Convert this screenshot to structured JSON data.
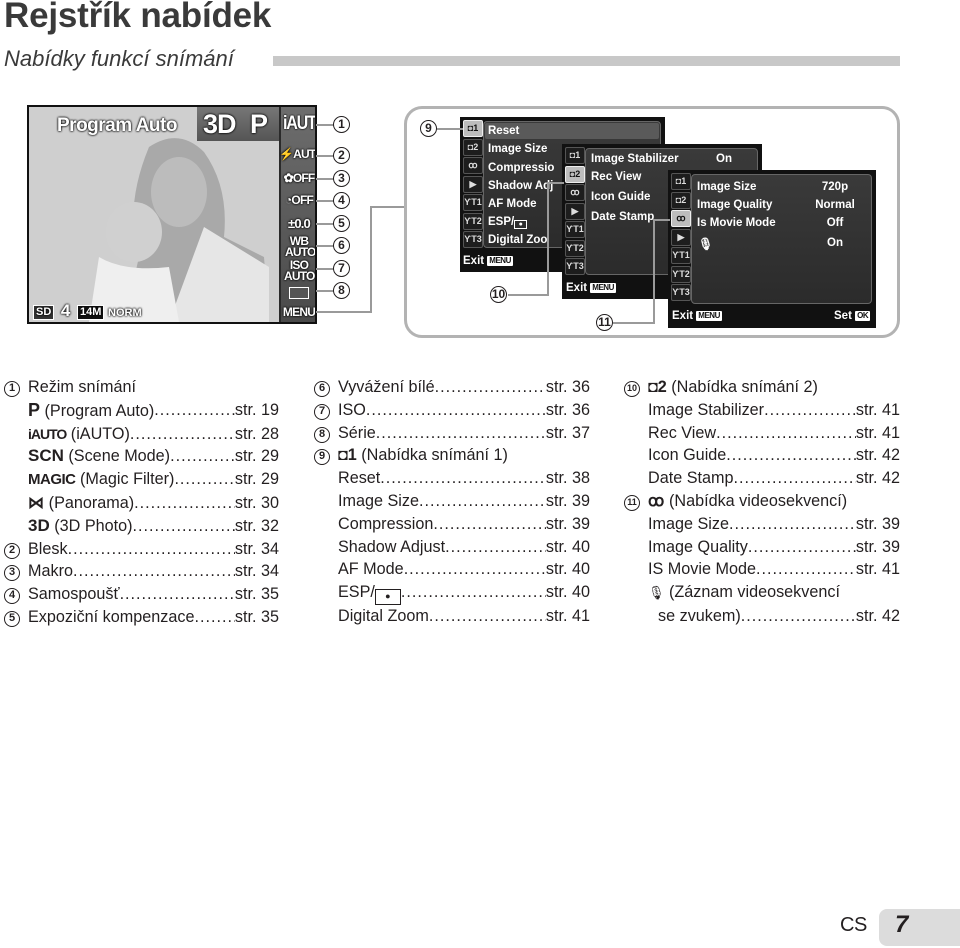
{
  "header": {
    "title": "Rejstřík nabídek",
    "subtitle": "Nabídky funkcí snímání"
  },
  "camera_screen": {
    "mode_label": "Program Auto",
    "mode_icons": [
      "3D",
      "P",
      "iAUTO"
    ],
    "side_items": [
      {
        "icon": "flash-auto-icon",
        "text": "⚡AUTO"
      },
      {
        "icon": "macro-off-icon",
        "text": "✿OFF"
      },
      {
        "icon": "self-timer-off-icon",
        "text": "◔OFF"
      },
      {
        "icon": "exposure-icon",
        "text": "±0.0"
      },
      {
        "icon": "white-balance-icon",
        "text": "WB AUTO"
      },
      {
        "icon": "iso-icon",
        "text": "ISO AUTO"
      },
      {
        "icon": "drive-mode-icon",
        "text": ""
      },
      {
        "icon": "menu-button",
        "text": "MENU"
      }
    ],
    "bottom": {
      "card": "SD",
      "shots": "4",
      "size": "14M",
      "quality": "NORM"
    }
  },
  "callouts": [
    "1",
    "2",
    "3",
    "4",
    "5",
    "6",
    "7",
    "8",
    "9",
    "10",
    "11"
  ],
  "menus": {
    "shooting1": {
      "items": [
        "Reset",
        "Image Size",
        "Compressio",
        "Shadow Adj",
        "AF Mode",
        "ESP/",
        "Digital Zoo"
      ],
      "exit": "Exit",
      "exit_key": "MENU"
    },
    "shooting2": {
      "items": [
        "Image Stabilizer",
        "Rec View",
        "Icon Guide",
        "Date Stamp"
      ],
      "values": [
        "On",
        "",
        "",
        ""
      ],
      "exit": "Exit",
      "exit_key": "MENU"
    },
    "movie": {
      "items": [
        "Image Size",
        "Image Quality",
        "Is Movie Mode",
        ""
      ],
      "values": [
        "720p",
        "Normal",
        "Off",
        "On"
      ],
      "exit": "Exit",
      "exit_key": "MENU",
      "set": "Set",
      "set_key": "OK"
    },
    "tabs": [
      "◘1",
      "◘2",
      "ꝏ",
      "▶",
      "ƳT1",
      "ƳT2",
      "ƳT3"
    ]
  },
  "index": {
    "col1": [
      {
        "num": "1",
        "label": "Režim snímání",
        "page": ""
      },
      {
        "icon": "P",
        "label": " (Program Auto)",
        "page": "str. 19"
      },
      {
        "icon": "iAUTO",
        "label": " (iAUTO)",
        "page": "str. 28"
      },
      {
        "icon": "SCN",
        "label": " (Scene Mode)",
        "page": "str. 29"
      },
      {
        "icon": "MAGIC",
        "label": " (Magic Filter)",
        "page": "str. 29"
      },
      {
        "icon": "⋈",
        "label": " (Panorama)",
        "page": "str. 30"
      },
      {
        "icon": "3D",
        "label": " (3D Photo)",
        "page": "str. 32"
      },
      {
        "num": "2",
        "label": "Blesk",
        "page": "str. 34"
      },
      {
        "num": "3",
        "label": "Makro",
        "page": "str. 34"
      },
      {
        "num": "4",
        "label": "Samospoušť",
        "page": "str. 35"
      },
      {
        "num": "5",
        "label": "Expoziční kompenzace",
        "page": "str. 35"
      }
    ],
    "col2": [
      {
        "num": "6",
        "label": "Vyvážení bílé",
        "page": "str. 36"
      },
      {
        "num": "7",
        "label": "ISO",
        "page": "str. 36"
      },
      {
        "num": "8",
        "label": "Série",
        "page": "str. 37"
      },
      {
        "num": "9",
        "icon": "◘1",
        "label": " (Nabídka snímání 1)",
        "page": ""
      },
      {
        "label": "Reset",
        "page": "str. 38"
      },
      {
        "label": "Image Size",
        "page": "str. 39"
      },
      {
        "label": "Compression",
        "page": "str. 39"
      },
      {
        "label": "Shadow Adjust",
        "page": "str. 40"
      },
      {
        "label": "AF Mode",
        "page": "str. 40"
      },
      {
        "label": "ESP/",
        "page": "str. 40"
      },
      {
        "label": "Digital Zoom",
        "page": "str. 41"
      }
    ],
    "col3": [
      {
        "num": "10",
        "icon": "◘2",
        "label": " (Nabídka snímání 2)",
        "page": ""
      },
      {
        "label": "Image Stabilizer",
        "page": "str. 41"
      },
      {
        "label": "Rec View",
        "page": "str. 41"
      },
      {
        "label": "Icon Guide",
        "page": "str. 42"
      },
      {
        "label": "Date Stamp",
        "page": "str. 42"
      },
      {
        "num": "11",
        "icon": "ꝏ",
        "label": " (Nabídka videosekvencí)",
        "page": ""
      },
      {
        "label": "Image Size",
        "page": "str. 39"
      },
      {
        "label": "Image Quality",
        "page": "str. 39"
      },
      {
        "label": "IS Movie Mode",
        "page": "str. 41"
      },
      {
        "icon": "🎙",
        "label": " (Záznam videosekvencí",
        "page": ""
      },
      {
        "label": "se zvukem)",
        "page": "str. 42"
      }
    ]
  },
  "footer": {
    "lang": "CS",
    "page_number": "7"
  }
}
